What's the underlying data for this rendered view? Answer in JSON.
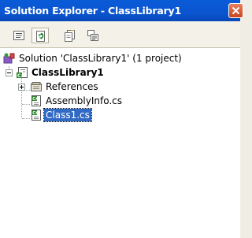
{
  "window": {
    "title": "Solution Explorer - ClassLibrary1"
  },
  "toolbar": {
    "buttons": [
      {
        "name": "properties",
        "icon": "properties-icon",
        "active": false
      },
      {
        "name": "refresh",
        "icon": "refresh-icon",
        "active": true
      },
      {
        "name": "show-all-files",
        "icon": "show-all-files-icon",
        "active": false
      },
      {
        "name": "view-code",
        "icon": "view-code-icon",
        "active": false
      }
    ]
  },
  "tree": {
    "solution": {
      "label": "Solution 'ClassLibrary1' (1 project)",
      "icon": "solution-icon"
    },
    "project": {
      "label": "ClassLibrary1",
      "icon": "csharp-project-icon",
      "expanded": true
    },
    "items": [
      {
        "label": "References",
        "icon": "references-icon",
        "expander": "collapsed"
      },
      {
        "label": "AssemblyInfo.cs",
        "icon": "csharp-file-icon"
      },
      {
        "label": "Class1.cs",
        "icon": "csharp-file-icon",
        "selected": true
      }
    ]
  },
  "colors": {
    "titlebar": "#0a55d0",
    "selection": "#316ac5",
    "close": "#c8451f"
  }
}
